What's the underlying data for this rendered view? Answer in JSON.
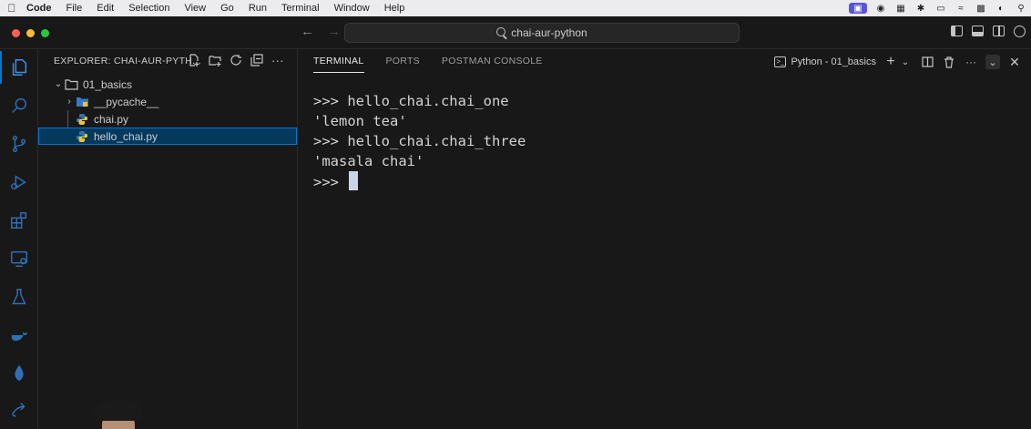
{
  "menubar": {
    "app": "Code",
    "items": [
      "File",
      "Edit",
      "Selection",
      "View",
      "Go",
      "Run",
      "Terminal",
      "Window",
      "Help"
    ]
  },
  "titlebar": {
    "search_text": "chai-aur-python"
  },
  "sidebar": {
    "header": "EXPLORER: CHAI-AUR-PYTH...",
    "tree": {
      "folder": "01_basics",
      "subfolder": "__pycache__",
      "file1": "chai.py",
      "file2": "hello_chai.py"
    }
  },
  "panel": {
    "tabs": [
      "TERMINAL",
      "PORTS",
      "POSTMAN CONSOLE"
    ],
    "active_tab": "TERMINAL",
    "terminal_name": "Python - 01_basics"
  },
  "terminal": {
    "lines": [
      ">>> hello_chai.chai_one",
      "'lemon tea'",
      ">>> hello_chai.chai_three",
      "'masala chai'"
    ],
    "prompt": ">>> "
  },
  "colors": {
    "background": "#181818",
    "accent": "#0078d4",
    "selected_row": "#04395e",
    "python_blue": "#3572A5",
    "python_yellow": "#f0c330"
  }
}
